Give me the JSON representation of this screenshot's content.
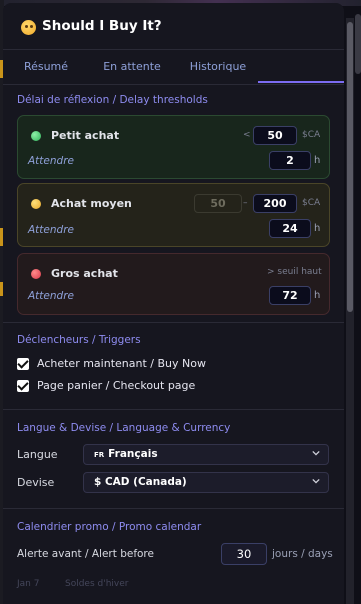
{
  "app": {
    "title": "Should I Buy It?"
  },
  "tabs": [
    {
      "label": "Résumé"
    },
    {
      "label": "En attente"
    },
    {
      "label": "Historique"
    },
    {
      "label": "",
      "icon": "gear-icon",
      "active": true
    }
  ],
  "delay": {
    "section_title": "Délai de réflexion / Delay thresholds",
    "small": {
      "label": "Petit achat",
      "lt_symbol": "<",
      "max": "50",
      "currency": "$CA",
      "wait_label": "Attendre",
      "hours": "2",
      "unit": "h"
    },
    "medium": {
      "label": "Achat moyen",
      "min": "50",
      "dash": "–",
      "max": "200",
      "currency": "$CA",
      "wait_label": "Attendre",
      "hours": "24",
      "unit": "h"
    },
    "large": {
      "label": "Gros achat",
      "threshold_note": "> seuil haut",
      "wait_label": "Attendre",
      "hours": "72",
      "unit": "h"
    }
  },
  "triggers": {
    "section_title": "Déclencheurs / Triggers",
    "items": [
      {
        "label": "Acheter maintenant / Buy Now",
        "checked": true
      },
      {
        "label": "Page panier / Checkout page",
        "checked": true
      }
    ]
  },
  "locale": {
    "section_title": "Langue & Devise / Language & Currency",
    "language_label": "Langue",
    "language_flag": "FR",
    "language_value": "Français",
    "currency_label": "Devise",
    "currency_value": "$ CAD (Canada)"
  },
  "promo": {
    "section_title": "Calendrier promo / Promo calendar",
    "alert_label": "Alerte avant / Alert before",
    "alert_value": "30",
    "alert_unit": "jours / days",
    "faint_row_date": "Jan 7",
    "faint_row_text": "Soldes d'hiver"
  },
  "colors": {
    "accent": "#7c6cf2",
    "section_title": "#8e8cf0",
    "tab_text": "#8ea0d8",
    "green_card": "#18261c",
    "yellow_card": "#24231a",
    "red_card": "#221a1c"
  }
}
